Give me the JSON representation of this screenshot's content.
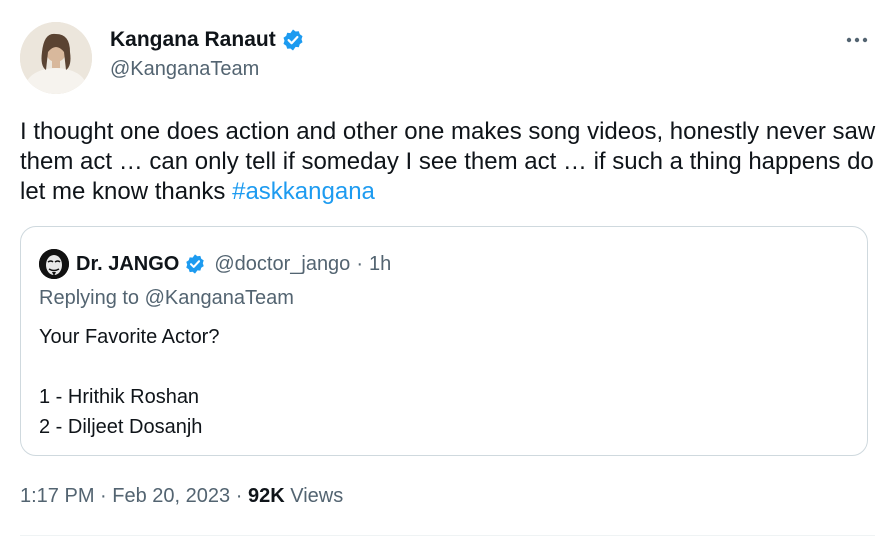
{
  "author": {
    "name": "Kangana Ranaut",
    "handle": "@KanganaTeam",
    "verified": true
  },
  "tweet": {
    "text": "I thought one does action and other one makes song videos, honestly never saw them act … can only tell if someday I see them act … if such a thing happens do let me know thanks ",
    "hashtag": "#askkangana"
  },
  "quoted_tweet": {
    "name": "Dr. JANGO",
    "handle": "@doctor_jango",
    "separator": "·",
    "time": "1h",
    "verified": true,
    "replying_to": "Replying to @KanganaTeam",
    "lines": [
      "Your Favorite Actor?",
      "",
      "1 - Hrithik Roshan",
      "2 - Diljeet Dosanjh"
    ]
  },
  "meta": {
    "time": "1:17 PM",
    "date": "Feb 20, 2023",
    "separator": "·",
    "views_count": "92K",
    "views_label": "Views"
  },
  "colors": {
    "link": "#1d9bf0",
    "verified": "#1d9bf0",
    "secondary_text": "#536471",
    "border": "#cfd9de"
  }
}
